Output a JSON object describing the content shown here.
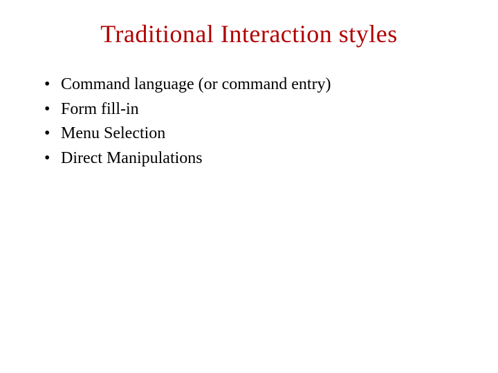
{
  "title": "Traditional Interaction styles",
  "bullets": {
    "b0": "Command language (or command entry)",
    "b1": "Form fill-in",
    "b2": "Menu Selection",
    "b3": "Direct Manipulations"
  },
  "glyphs": {
    "dot": "•"
  }
}
